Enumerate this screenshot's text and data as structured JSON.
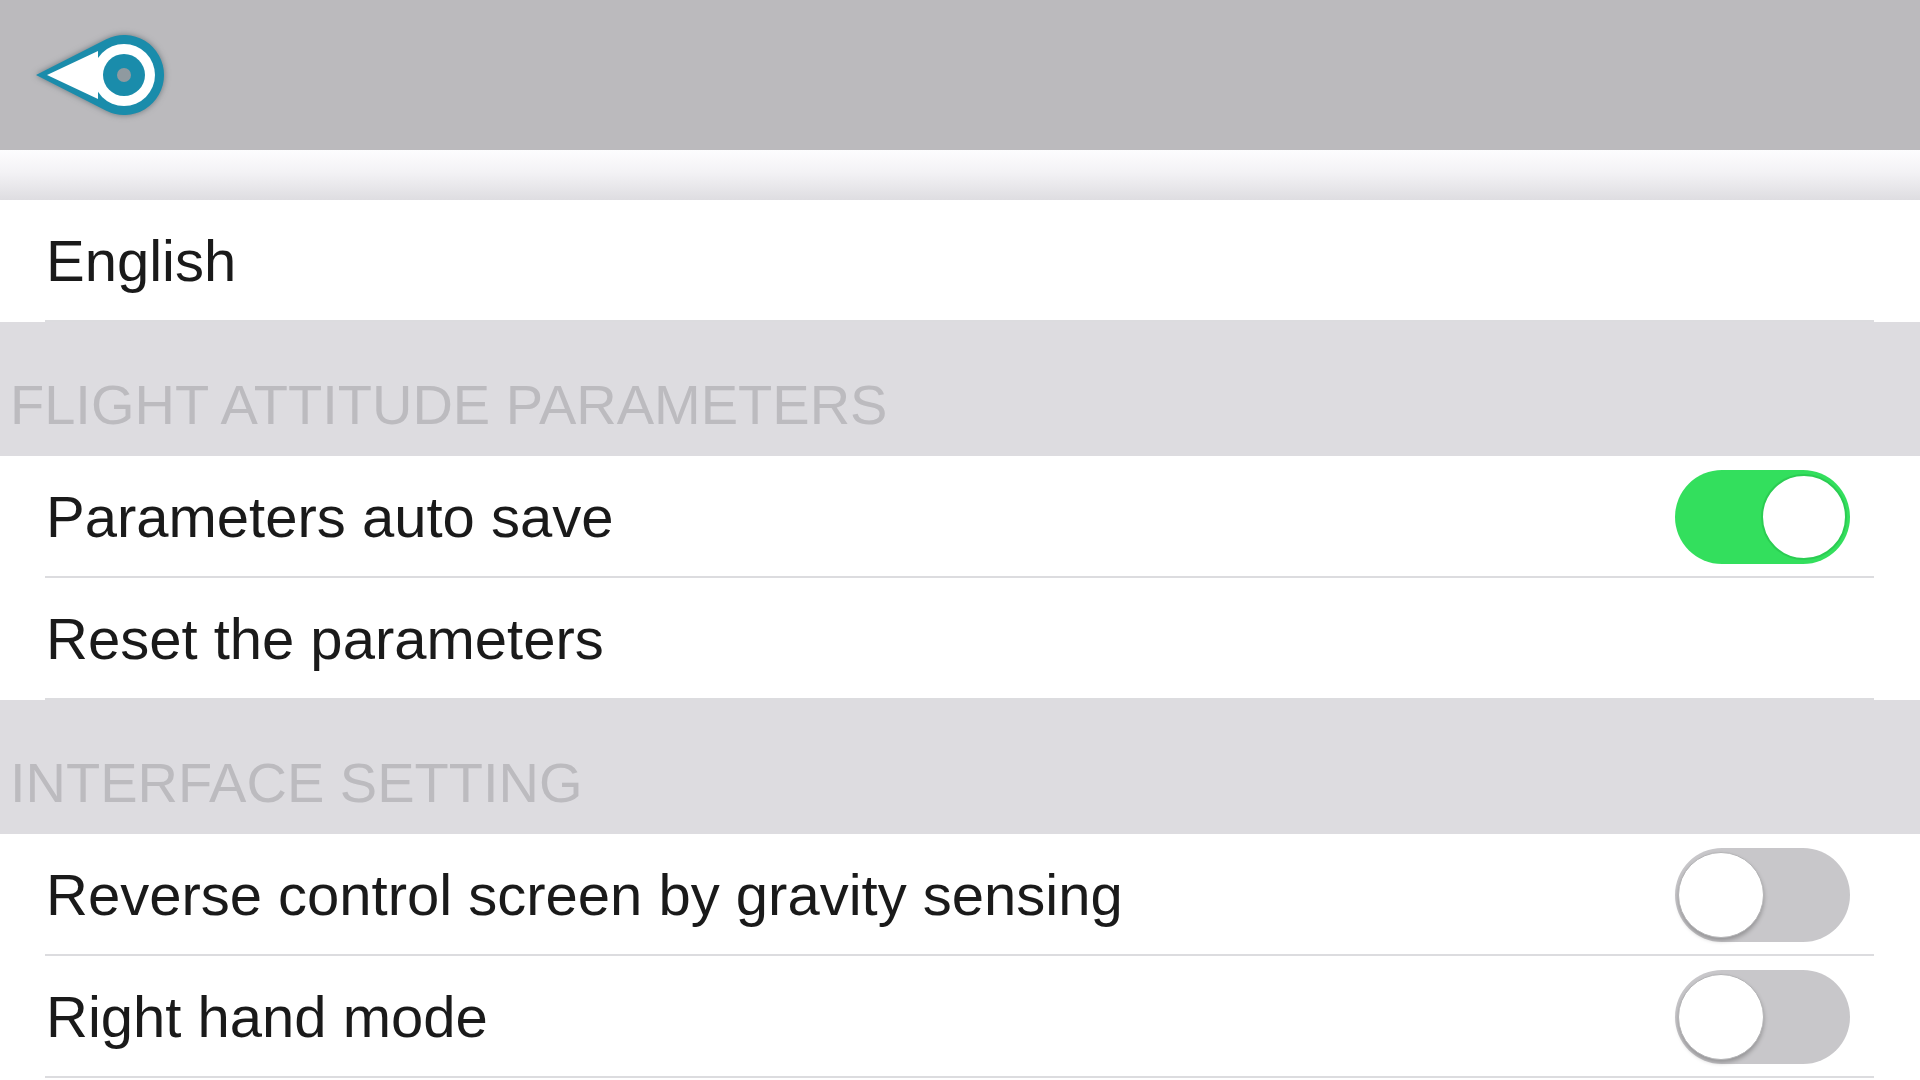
{
  "sections": [
    {
      "rows": [
        {
          "kind": "option",
          "label": "English"
        }
      ]
    },
    {
      "title": "FLIGHT ATTITUDE PARAMETERS",
      "rows": [
        {
          "kind": "switch",
          "label": "Parameters auto save",
          "on": true
        },
        {
          "kind": "option",
          "label": "Reset the parameters"
        }
      ]
    },
    {
      "title": "INTERFACE SETTING",
      "rows": [
        {
          "kind": "switch",
          "label": "Reverse control screen by gravity sensing",
          "on": false
        },
        {
          "kind": "switch",
          "label": "Right hand mode",
          "on": false
        }
      ]
    }
  ]
}
